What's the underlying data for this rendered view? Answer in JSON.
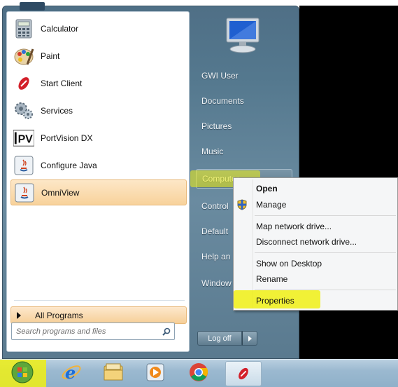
{
  "programs": [
    {
      "label": "Calculator",
      "icon": "calculator-icon"
    },
    {
      "label": "Paint",
      "icon": "paint-palette-icon"
    },
    {
      "label": "Start Client",
      "icon": "start-client-icon"
    },
    {
      "label": "Services",
      "icon": "services-gear-icon"
    },
    {
      "label": "PortVision DX",
      "icon": "portvision-icon"
    },
    {
      "label": "Configure Java",
      "icon": "java-icon"
    },
    {
      "label": "OmniView",
      "icon": "java-icon"
    }
  ],
  "all_programs_label": "All Programs",
  "search": {
    "placeholder": "Search programs and files"
  },
  "right_pane": {
    "user": "GWI User",
    "documents": "Documents",
    "pictures": "Pictures",
    "music": "Music",
    "computer": "Computer",
    "control_panel": "Control",
    "default_programs": "Default",
    "help": "Help an",
    "windows": "Window"
  },
  "logoff_label": "Log off",
  "context_menu": {
    "open": "Open",
    "manage": "Manage",
    "map_drive": "Map network drive...",
    "disconnect_drive": "Disconnect network drive...",
    "show_desktop": "Show on Desktop",
    "rename": "Rename",
    "properties": "Properties"
  },
  "colors": {
    "highlight_yellow": "#f0f014",
    "menu_hover_orange": "#f8d29b",
    "taskbar_blue": "#9bb9d0"
  }
}
